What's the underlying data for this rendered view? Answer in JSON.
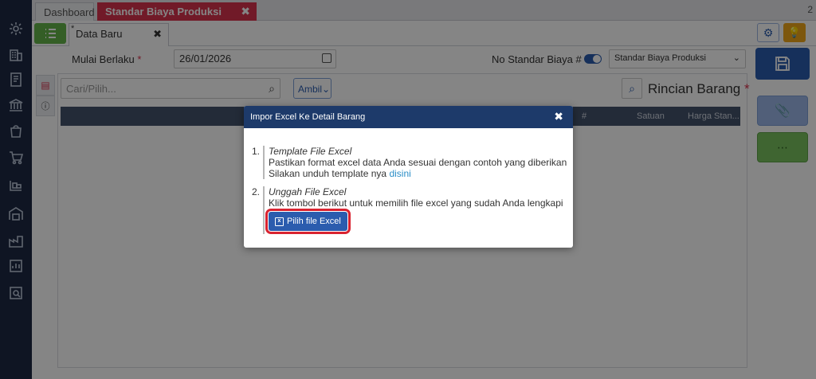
{
  "tabs": {
    "dashboard": "Dashboard",
    "active": "Standar Biaya Produksi",
    "close_glyph": "✖",
    "count": "2"
  },
  "subtab": {
    "marker": "*",
    "label": "Data Baru",
    "close_glyph": "✖"
  },
  "form": {
    "mulai_label": "Mulai Berlaku",
    "required_mark": "*",
    "date_value": "26/01/2026",
    "no_standar_label": "No Standar Biaya #",
    "select_value": "Standar Biaya Produksi",
    "search_placeholder": "Cari/Pilih...",
    "ambil_label": "Ambil",
    "rincian_label": "Rincian Barang"
  },
  "table": {
    "columns": [
      "#",
      "Satuan",
      "Harga Stan..."
    ]
  },
  "modal": {
    "title": "Impor Excel Ke Detail Barang",
    "close_glyph": "✖",
    "step1": {
      "num": "1.",
      "title": "Template File Excel",
      "desc": "Pastikan format excel data Anda sesuai dengan contoh yang diberikan",
      "download_text": "Silakan unduh template nya",
      "link_text": "disini"
    },
    "step2": {
      "num": "2.",
      "title": "Unggah File Excel",
      "desc": "Klik tombol berikut untuk memilih file excel yang sudah Anda lengkapi",
      "button_label": "Pilih file Excel"
    }
  },
  "colors": {
    "nav_bg": "#1d2a44",
    "accent_red": "#d9324e",
    "primary_blue": "#2b5cae",
    "modal_header": "#1d3a6a",
    "highlight_red": "#d92330"
  }
}
